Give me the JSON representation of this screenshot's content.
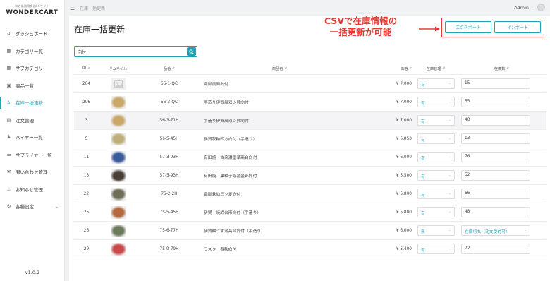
{
  "logo": {
    "sub": "和の業務用食器ECサイト",
    "main": "WONDERCART"
  },
  "sidebar": {
    "items": [
      {
        "label": "ダッシュボード",
        "icon": "home-icon"
      },
      {
        "label": "カテゴリ一覧",
        "icon": "grid-icon"
      },
      {
        "label": "サブカテゴリ",
        "icon": "grid-icon"
      },
      {
        "label": "商品一覧",
        "icon": "box-icon"
      },
      {
        "label": "在庫一括更新",
        "icon": "home-icon",
        "active": true
      },
      {
        "label": "注文管理",
        "icon": "document-icon"
      },
      {
        "label": "バイヤー一覧",
        "icon": "users-icon"
      },
      {
        "label": "サプライヤー一覧",
        "icon": "list-icon"
      },
      {
        "label": "問い合わせ管理",
        "icon": "mail-icon"
      },
      {
        "label": "お知らせ管理",
        "icon": "bell-icon"
      },
      {
        "label": "各種設定",
        "icon": "gear-icon"
      }
    ],
    "version": "v1.0.2"
  },
  "topbar": {
    "breadcrumb": "在庫一括更新",
    "user": "Admin"
  },
  "page": {
    "title": "在庫一括更新"
  },
  "actions": {
    "export_label": "エクスポート",
    "import_label": "インポート"
  },
  "annotation": {
    "line1": "CSVで在庫情報の",
    "line2": "一括更新が可能"
  },
  "search": {
    "value": "向付"
  },
  "table": {
    "headers": {
      "id": "ID",
      "thumb": "サムネイル",
      "code": "品番",
      "name": "商品名",
      "price": "価格",
      "mgmt": "在庫管理",
      "stock": "在庫数"
    },
    "rows": [
      {
        "id": "204",
        "code": "56-1-QC",
        "name": "織部扇面向付",
        "price": "¥ 7,000",
        "mgmt": "有",
        "stock": "15",
        "thumb": "placeholder"
      },
      {
        "id": "206",
        "code": "56-3-QC",
        "name": "手造り伊賀風双ツ貝向付",
        "price": "¥ 7,000",
        "mgmt": "有",
        "stock": "55",
        "thumb": "#c9a86a"
      },
      {
        "id": "3",
        "code": "56-3-71H",
        "name": "手造り伊賀風双ツ貝向付",
        "price": "¥ 7,000",
        "mgmt": "有",
        "stock": "40",
        "thumb": "#c9a86a"
      },
      {
        "id": "5",
        "code": "56-5-45H",
        "name": "伊賀灰釉四方向付（手造り）",
        "price": "¥ 5,850",
        "mgmt": "有",
        "stock": "13",
        "thumb": "#bfae7a"
      },
      {
        "id": "11",
        "code": "57-3-93H",
        "name": "有田焼　古染濃墨草高台向付",
        "price": "¥ 6,000",
        "mgmt": "有",
        "stock": "76",
        "thumb": "#3a5a9a"
      },
      {
        "id": "13",
        "code": "57-5-93H",
        "name": "有田焼　黒釉子絵晶金彩向付",
        "price": "¥ 5,500",
        "mgmt": "有",
        "stock": "52",
        "thumb": "#4a4038"
      },
      {
        "id": "22",
        "code": "75-2-2H",
        "name": "織部鉄仙三ツ足向付",
        "price": "¥ 5,800",
        "mgmt": "有",
        "stock": "66",
        "thumb": "#6e6e58"
      },
      {
        "id": "25",
        "code": "75-5-45H",
        "name": "伊賀　焼締台形向付（手造り）",
        "price": "¥ 5,800",
        "mgmt": "有",
        "stock": "48",
        "thumb": "#b5683e"
      },
      {
        "id": "26",
        "code": "75-6-77H",
        "name": "伊賀釉うず潮高台向付（手造り）",
        "price": "¥ 6,000",
        "mgmt": "無",
        "stock": "在庫切れ（注文受付可）",
        "thumb": "#6b7a5a",
        "stock_dropdown": true
      },
      {
        "id": "29",
        "code": "75-9-79H",
        "name": "ラスター春秋向付",
        "price": "¥ 5,400",
        "mgmt": "有",
        "stock": "72",
        "thumb": "#c94a4a"
      }
    ]
  }
}
